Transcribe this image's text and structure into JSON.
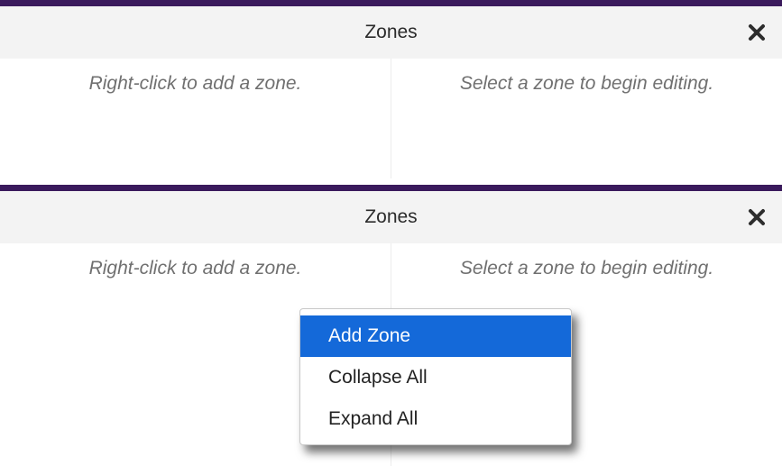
{
  "colors": {
    "accent_border": "#3a1a5c",
    "menu_highlight": "#1469d9"
  },
  "panels": [
    {
      "title": "Zones",
      "close_icon": "close-icon",
      "left_hint": "Right-click to add a zone.",
      "right_hint": "Select a zone to begin editing."
    },
    {
      "title": "Zones",
      "close_icon": "close-icon",
      "left_hint": "Right-click to add a zone.",
      "right_hint": "Select a zone to begin editing."
    }
  ],
  "context_menu": {
    "items": [
      {
        "label": "Add Zone",
        "highlighted": true
      },
      {
        "label": "Collapse All",
        "highlighted": false
      },
      {
        "label": "Expand All",
        "highlighted": false
      }
    ]
  }
}
